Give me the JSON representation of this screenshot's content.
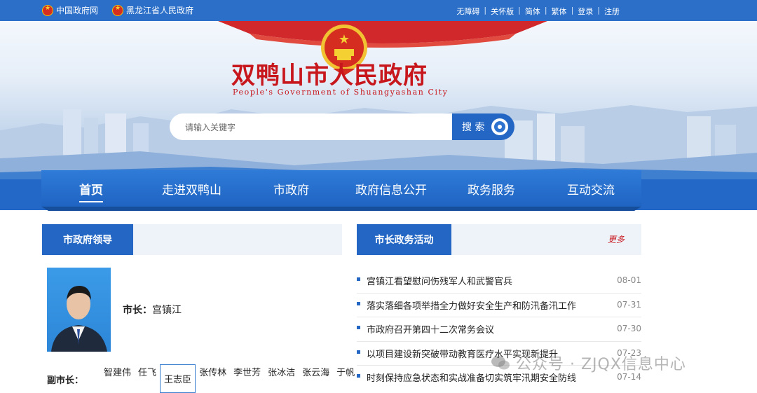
{
  "topbar": {
    "links": [
      {
        "label": "中国政府网"
      },
      {
        "label": "黑龙江省人民政府"
      }
    ],
    "tools": [
      "无障碍",
      "关怀版",
      "简体",
      "繁体",
      "登录",
      "注册"
    ]
  },
  "header": {
    "title": "双鸭山市人民政府",
    "subtitle": "People's Government of Shuangyashan City"
  },
  "search": {
    "placeholder": "请输入关键字",
    "button_label": "搜 索"
  },
  "nav": {
    "items": [
      "首页",
      "走进双鸭山",
      "市政府",
      "政府信息公开",
      "政务服务",
      "互动交流"
    ],
    "active_index": 0
  },
  "leaders_panel": {
    "title": "市政府领导",
    "mayor_label": "市长：",
    "mayor_name": "宫镇江",
    "deputy_label": "副市长：",
    "deputies": [
      "智建伟",
      "任飞",
      "王志臣",
      "张传林",
      "李世芳",
      "张冰洁",
      "张云海",
      "于帆"
    ],
    "selected_deputy_index": 2
  },
  "activities_panel": {
    "title": "市长政务活动",
    "more_label": "更多",
    "items": [
      {
        "title": "宫镇江看望慰问伤残军人和武警官兵",
        "date": "08-01"
      },
      {
        "title": "落实落细各项举措全力做好安全生产和防汛备汛工作",
        "date": "07-31"
      },
      {
        "title": "市政府召开第四十二次常务会议",
        "date": "07-30"
      },
      {
        "title": "以项目建设新突破带动教育医疗水平实现新提升",
        "date": "07-23"
      },
      {
        "title": "时刻保持应急状态和实战准备切实筑牢汛期安全防线",
        "date": "07-14"
      }
    ]
  },
  "watermark": {
    "text": "公众号 · ZJQX信息中心"
  },
  "colors": {
    "brand_blue": "#2366c4",
    "title_red": "#c8161d",
    "more_red": "#c8161d"
  }
}
